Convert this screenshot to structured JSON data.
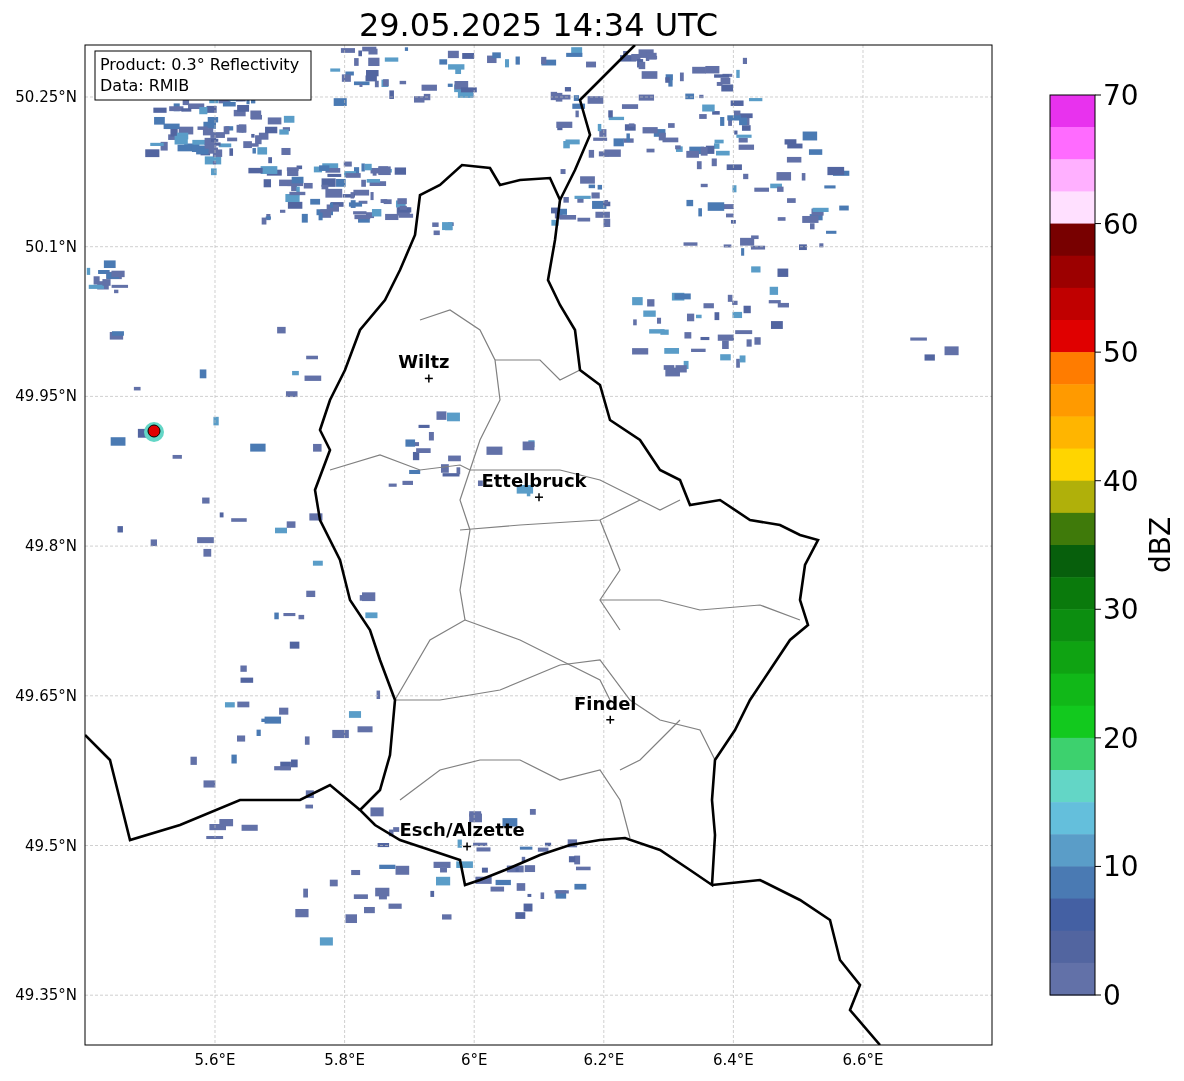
{
  "title": "29.05.2025 14:34 UTC",
  "info_box": [
    "Product: 0.3° Reflectivity",
    "Data: RMIB"
  ],
  "y_ticks": [
    "50.25°N",
    "50.1°N",
    "49.95°N",
    "49.8°N",
    "49.65°N",
    "49.5°N",
    "49.35°N"
  ],
  "x_ticks": [
    "5.6°E",
    "5.8°E",
    "6°E",
    "6.2°E",
    "6.4°E",
    "6.6°E"
  ],
  "cities": [
    "Wiltz",
    "Ettelbruck",
    "Findel",
    "Esch/Alzette"
  ],
  "colorbar": {
    "label": "dBZ",
    "ticks": [
      "70",
      "60",
      "50",
      "40",
      "30",
      "20",
      "10",
      "0"
    ],
    "segments": [
      {
        "color": "#e832ee"
      },
      {
        "color": "#ff6bff"
      },
      {
        "color": "#ffb0ff"
      },
      {
        "color": "#ffe0ff"
      },
      {
        "color": "#780000"
      },
      {
        "color": "#9c0000"
      },
      {
        "color": "#c00000"
      },
      {
        "color": "#e00000"
      },
      {
        "color": "#ff7c00"
      },
      {
        "color": "#ff9a00"
      },
      {
        "color": "#ffb500"
      },
      {
        "color": "#ffd500"
      },
      {
        "color": "#b0b00a"
      },
      {
        "color": "#3f7a0a"
      },
      {
        "color": "#075f0c"
      },
      {
        "color": "#0a7a0c"
      },
      {
        "color": "#0c8e10"
      },
      {
        "color": "#0fa312"
      },
      {
        "color": "#11b818"
      },
      {
        "color": "#12c91e"
      },
      {
        "color": "#3dd16e"
      },
      {
        "color": "#63d6c6"
      },
      {
        "color": "#64bfdc"
      },
      {
        "color": "#5a9dc8"
      },
      {
        "color": "#4a7ab3"
      },
      {
        "color": "#4460a3"
      },
      {
        "color": "#5265a0"
      },
      {
        "color": "#6271a8"
      }
    ]
  }
}
